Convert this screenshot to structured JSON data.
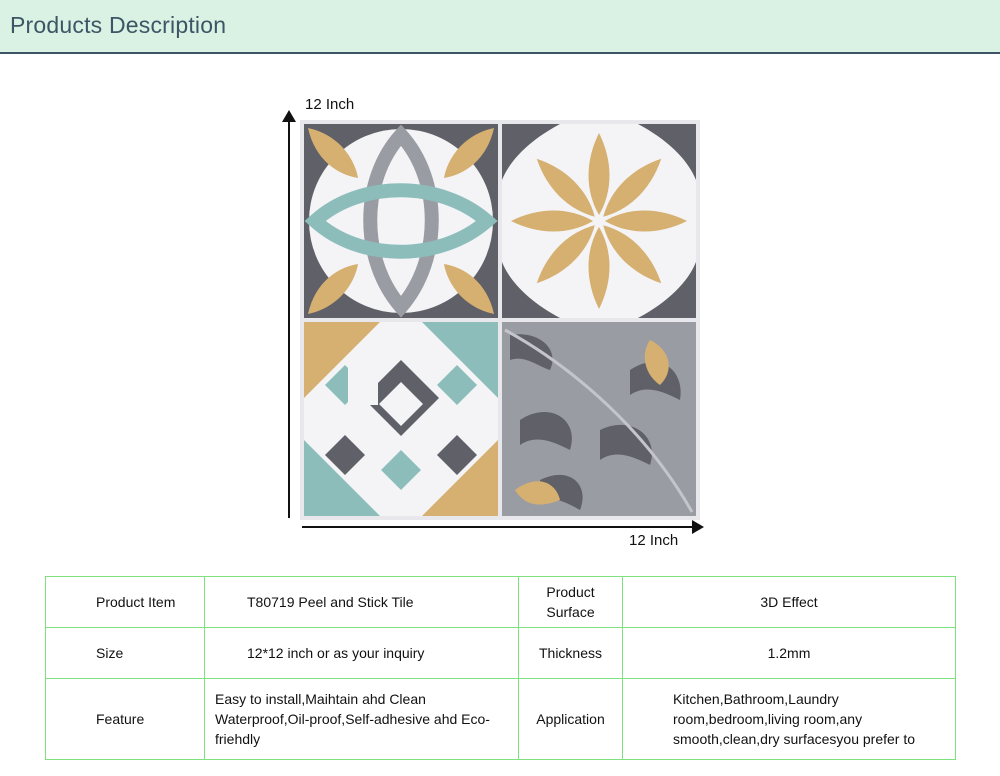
{
  "header": {
    "title": "Products Description"
  },
  "dimensions": {
    "height_label": "12 Inch",
    "width_label": "12 Inch"
  },
  "tile_image": {
    "colors": {
      "gray_dark": "#5f6068",
      "gray_mid": "#9a9ca3",
      "teal": "#8cbdbb",
      "tan": "#d6b071",
      "white": "#f4f4f6"
    }
  },
  "spec_table": {
    "rows": [
      {
        "label_1": "Product Item",
        "value_1": "T80719 Peel and Stick Tile",
        "label_2": "Product Surface",
        "value_2": "3D Effect"
      },
      {
        "label_1": "Size",
        "value_1": "12*12 inch or as your inquiry",
        "label_2": "Thickness",
        "value_2": "1.2mm"
      },
      {
        "label_1": "Feature",
        "value_1": "Easy to install,Maihtain ahd Clean Waterproof,Oil-proof,Self-adhesive ahd Eco-friehdly",
        "label_2": "Application",
        "value_2": "Kitchen,Bathroom,Laundry room,bedroom,living room,any smooth,clean,dry surfacesyou prefer to"
      }
    ]
  }
}
